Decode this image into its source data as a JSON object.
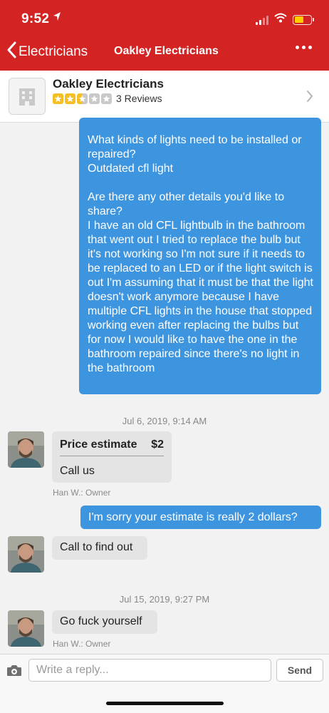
{
  "status_bar": {
    "time": "9:52"
  },
  "nav": {
    "back_label": "Electricians",
    "title": "Oakley Electricians"
  },
  "business": {
    "name": "Oakley Electricians",
    "rating": 2.5,
    "max_rating": 5,
    "reviews_label": "3 Reviews"
  },
  "messages": {
    "first_outgoing": "What kinds of lights need to be installed or repaired?\nOutdated cfl light\n\nAre there any other details you'd like to share?\nI have an old CFL lightbulb in the bathroom that went out I tried to replace the bulb but it's not working so I'm not sure if it needs to be replaced to an LED or if the light switch is out I'm assuming that it must be that the light doesn't work anymore because I have multiple CFL lights in the house that stopped working even after replacing the bulbs but for now I would like to have the one in the bathroom repaired since there's no light in the bathroom",
    "timestamp_1": "Jul 6, 2019, 9:14 AM",
    "estimate_label": "Price estimate",
    "estimate_value": "$2",
    "estimate_note": "Call us",
    "sender_1": "Han W.: Owner",
    "outgoing_2": "I'm sorry your estimate is really 2 dollars?",
    "incoming_2": "Call to find out",
    "timestamp_2": "Jul 15, 2019, 9:27 PM",
    "incoming_3": "Go fuck yourself",
    "sender_3": "Han W.: Owner"
  },
  "composer": {
    "placeholder": "Write a reply...",
    "send_label": "Send"
  },
  "colors": {
    "header_red": "#d32323",
    "bubble_blue": "#3d95e0",
    "star_gold": "#f5c026"
  }
}
